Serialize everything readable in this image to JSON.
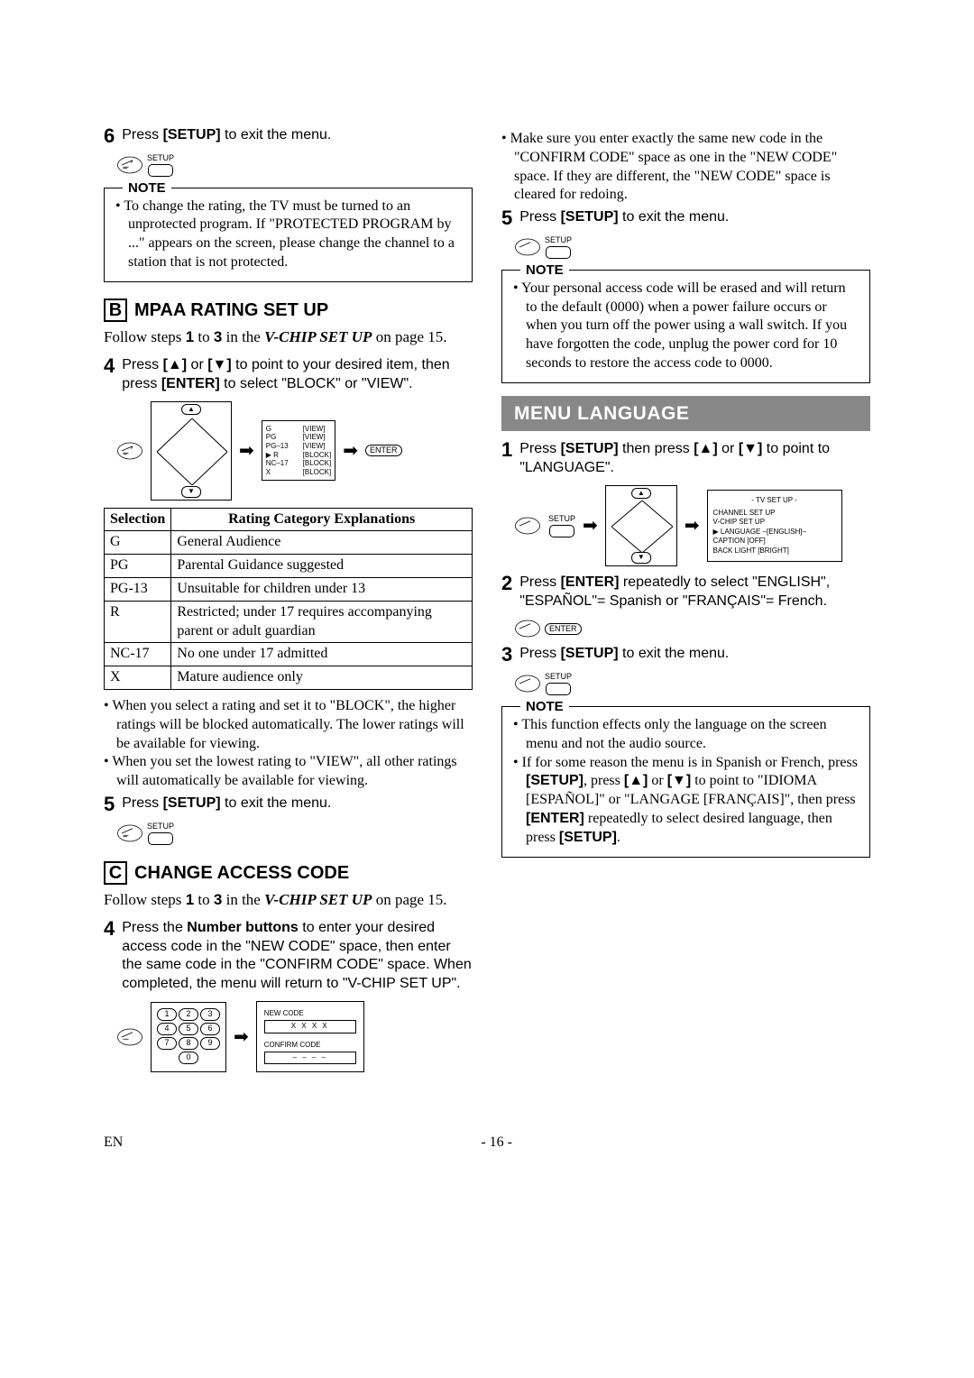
{
  "left": {
    "step6": {
      "num": "6",
      "text_prefix": "Press ",
      "setup": "[SETUP]",
      "text_suffix": " to exit the menu.",
      "btn_label": "SETUP"
    },
    "note1": {
      "title": "NOTE",
      "item": "To change the rating, the TV must be turned to an unprotected program. If \"PROTECTED PROGRAM by ...\" appears on the screen, please change the channel to a station that is not protected."
    },
    "sectionB": {
      "letter": "B",
      "title": "MPAA RATING SET UP",
      "follow_p1": "Follow steps ",
      "follow_b1": "1",
      "follow_p2": " to ",
      "follow_b2": "3",
      "follow_p3": " in the ",
      "follow_i": "V-CHIP SET UP",
      "follow_p4": " on page 15."
    },
    "step4b": {
      "num": "4",
      "body": "Press [▲] or [▼] to point to your desired item, then press [ENTER] to select \"BLOCK\" or \"VIEW\"."
    },
    "diagram_b": {
      "ratings": [
        "G",
        "PG",
        "PG–13",
        "R",
        "NC–17",
        "X"
      ],
      "states": [
        "[VIEW]",
        "[VIEW]",
        "[VIEW]",
        "[BLOCK]",
        "[BLOCK]",
        "[BLOCK]"
      ],
      "enter": "ENTER"
    },
    "ratings_table": {
      "h1": "Selection",
      "h2": "Rating Category Explanations",
      "rows": [
        {
          "sel": "G",
          "exp": "General Audience"
        },
        {
          "sel": "PG",
          "exp": "Parental Guidance suggested"
        },
        {
          "sel": "PG-13",
          "exp": "Unsuitable for children under 13"
        },
        {
          "sel": "R",
          "exp": "Restricted; under 17 requires accompanying parent or adult guardian"
        },
        {
          "sel": "NC-17",
          "exp": "No one under 17 admitted"
        },
        {
          "sel": "X",
          "exp": "Mature audience only"
        }
      ]
    },
    "bullets_b": [
      "When you select a rating and set it to \"BLOCK\", the higher ratings will be blocked automatically. The lower ratings will be available for viewing.",
      "When you set the lowest rating to \"VIEW\", all other ratings will automatically be available for viewing."
    ],
    "step5b": {
      "num": "5",
      "text": "Press [SETUP] to exit the menu.",
      "btn_label": "SETUP"
    },
    "sectionC": {
      "letter": "C",
      "title": "CHANGE ACCESS CODE",
      "follow_p1": "Follow steps ",
      "follow_b1": "1",
      "follow_p2": " to ",
      "follow_b2": "3",
      "follow_p3": " in the ",
      "follow_i": "V-CHIP SET UP",
      "follow_p4": " on page 15."
    },
    "step4c": {
      "num": "4",
      "body": "Press the Number buttons to enter your desired access code in the \"NEW CODE\" space, then enter the same code in the \"CONFIRM CODE\" space. When completed, the menu will return to \"V-CHIP SET UP\"."
    },
    "code_diagram": {
      "keys": [
        [
          "1",
          "2",
          "3"
        ],
        [
          "4",
          "5",
          "6"
        ],
        [
          "7",
          "8",
          "9"
        ],
        [
          "0"
        ]
      ],
      "new_code_label": "NEW CODE",
      "new_code_val": "X X X X",
      "confirm_label": "CONFIRM CODE",
      "confirm_val": "– – – –"
    }
  },
  "right": {
    "bullet_top": "Make sure you enter exactly the same new code in the \"CONFIRM CODE\" space as one in the \"NEW CODE\" space. If they are different, the \"NEW CODE\" space is cleared for redoing.",
    "step5r": {
      "num": "5",
      "text": "Press [SETUP] to exit the menu.",
      "btn_label": "SETUP"
    },
    "note2": {
      "title": "NOTE",
      "item": "Your personal access code will be erased and will return to the default (0000) when a power failure occurs or when you turn off the power using a wall switch. If you have forgotten the code, unplug the power cord for 10 seconds to restore the access code to 0000."
    },
    "banner": "MENU LANGUAGE",
    "step1": {
      "num": "1",
      "body": "Press [SETUP] then press [▲] or [▼] to point to \"LANGUAGE\".",
      "btn_label": "SETUP"
    },
    "tvsetup": {
      "title": "- TV SET UP -",
      "lines": [
        "CHANNEL SET UP",
        "V-CHIP SET UP",
        "LANGUAGE   –[ENGLISH]–",
        "CAPTION          [OFF]",
        "BACK LIGHT  [BRIGHT]"
      ]
    },
    "step2": {
      "num": "2",
      "body": "Press [ENTER] repeatedly to select \"ENGLISH\", \"ESPAÑOL\"= Spanish or \"FRANÇAIS\"= French.",
      "enter": "ENTER"
    },
    "step3": {
      "num": "3",
      "text": "Press [SETUP] to exit the menu.",
      "btn_label": "SETUP"
    },
    "note3": {
      "title": "NOTE",
      "items": [
        "This function effects only the language on the screen menu and not the audio source.",
        "If for some reason the menu is in Spanish or French, press [SETUP], press [▲] or [▼] to point to \"IDIOMA [ESPAÑOL]\" or \"LANGAGE [FRANÇAIS]\", then press [ENTER] repeatedly to select desired language, then press [SETUP]."
      ]
    }
  },
  "footer": {
    "left": "EN",
    "center": "- 16 -"
  }
}
